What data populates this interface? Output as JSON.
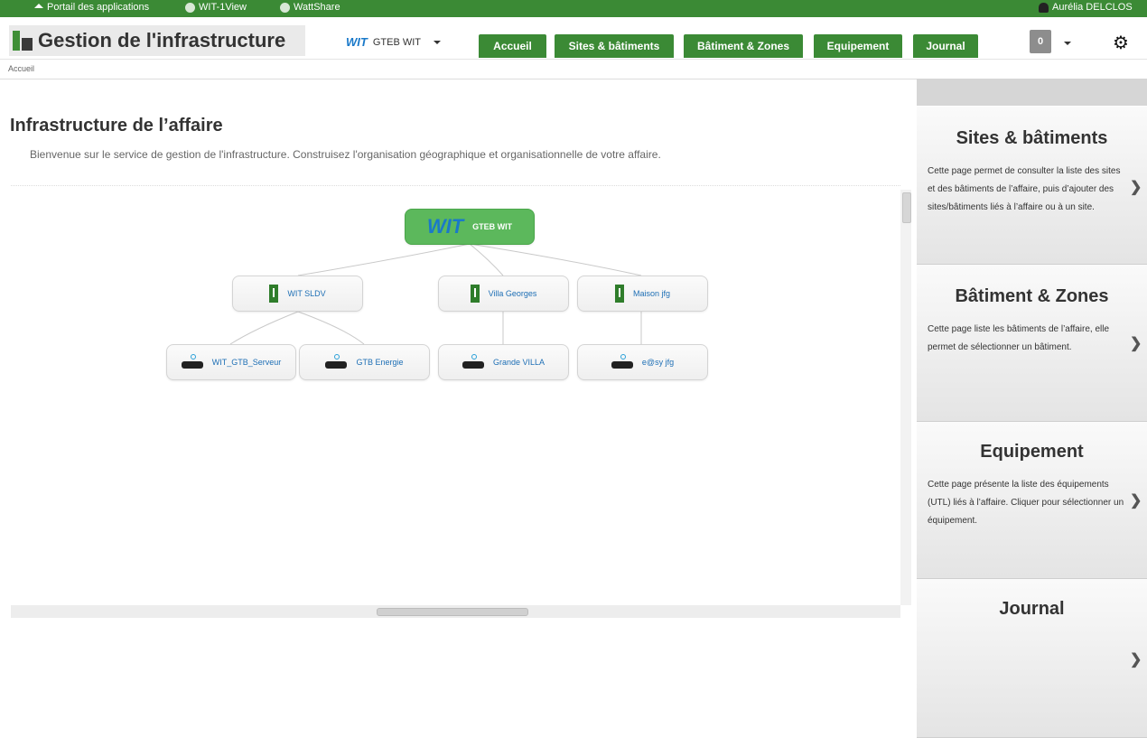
{
  "topbar": {
    "portal": "Portail des applications",
    "wit1view": "WIT-1View",
    "wattshare": "WattShare",
    "user": "Aurélia DELCLOS"
  },
  "header": {
    "title": "Gestion de l'infrastructure",
    "affaire_logo": "WIT",
    "affaire": "GTEB WIT",
    "nav": [
      "Accueil",
      "Sites & bâtiments",
      "Bâtiment & Zones",
      "Equipement",
      "Journal"
    ],
    "notif_count": "0"
  },
  "breadcrumb": "Accueil",
  "main": {
    "title": "Infrastructure de l’affaire",
    "intro": "Bienvenue sur le service de gestion de l'infrastructure. Construisez l'organisation géographique et organisationnelle de votre affaire."
  },
  "tree": {
    "root": "GTEB WIT",
    "sites": [
      "WIT SLDV",
      "Villa Georges",
      "Maison jfg"
    ],
    "devices": [
      "WIT_GTB_Serveur",
      "GTB Energie",
      "Grande VILLA",
      "e@sy jfg"
    ]
  },
  "cards": [
    {
      "title": "Sites & bâtiments",
      "desc": "Cette page permet de consulter la liste des sites et des bâtiments de l’affaire, puis d’ajouter des sites/bâtiments liés à l’affaire ou à un site."
    },
    {
      "title": "Bâtiment & Zones",
      "desc": "Cette page liste les bâtiments de l’affaire, elle permet de sélectionner un bâtiment."
    },
    {
      "title": "Equipement",
      "desc": "Cette page présente la liste des équipements (UTL) liés à l’affaire. Cliquer pour sélectionner un équipement."
    },
    {
      "title": "Journal",
      "desc": ""
    }
  ],
  "colors": {
    "green": "#3b8a35",
    "root_green": "#5cb85c",
    "link_blue": "#1e6fb5"
  }
}
